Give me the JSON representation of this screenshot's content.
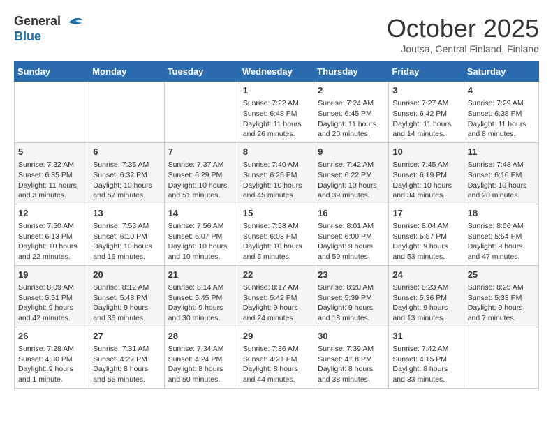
{
  "logo": {
    "general": "General",
    "blue": "Blue"
  },
  "title": "October 2025",
  "subtitle": "Joutsa, Central Finland, Finland",
  "days": [
    "Sunday",
    "Monday",
    "Tuesday",
    "Wednesday",
    "Thursday",
    "Friday",
    "Saturday"
  ],
  "weeks": [
    [
      {
        "num": "",
        "sunrise": "",
        "sunset": "",
        "daylight": ""
      },
      {
        "num": "",
        "sunrise": "",
        "sunset": "",
        "daylight": ""
      },
      {
        "num": "",
        "sunrise": "",
        "sunset": "",
        "daylight": ""
      },
      {
        "num": "1",
        "sunrise": "Sunrise: 7:22 AM",
        "sunset": "Sunset: 6:48 PM",
        "daylight": "Daylight: 11 hours and 26 minutes."
      },
      {
        "num": "2",
        "sunrise": "Sunrise: 7:24 AM",
        "sunset": "Sunset: 6:45 PM",
        "daylight": "Daylight: 11 hours and 20 minutes."
      },
      {
        "num": "3",
        "sunrise": "Sunrise: 7:27 AM",
        "sunset": "Sunset: 6:42 PM",
        "daylight": "Daylight: 11 hours and 14 minutes."
      },
      {
        "num": "4",
        "sunrise": "Sunrise: 7:29 AM",
        "sunset": "Sunset: 6:38 PM",
        "daylight": "Daylight: 11 hours and 8 minutes."
      }
    ],
    [
      {
        "num": "5",
        "sunrise": "Sunrise: 7:32 AM",
        "sunset": "Sunset: 6:35 PM",
        "daylight": "Daylight: 11 hours and 3 minutes."
      },
      {
        "num": "6",
        "sunrise": "Sunrise: 7:35 AM",
        "sunset": "Sunset: 6:32 PM",
        "daylight": "Daylight: 10 hours and 57 minutes."
      },
      {
        "num": "7",
        "sunrise": "Sunrise: 7:37 AM",
        "sunset": "Sunset: 6:29 PM",
        "daylight": "Daylight: 10 hours and 51 minutes."
      },
      {
        "num": "8",
        "sunrise": "Sunrise: 7:40 AM",
        "sunset": "Sunset: 6:26 PM",
        "daylight": "Daylight: 10 hours and 45 minutes."
      },
      {
        "num": "9",
        "sunrise": "Sunrise: 7:42 AM",
        "sunset": "Sunset: 6:22 PM",
        "daylight": "Daylight: 10 hours and 39 minutes."
      },
      {
        "num": "10",
        "sunrise": "Sunrise: 7:45 AM",
        "sunset": "Sunset: 6:19 PM",
        "daylight": "Daylight: 10 hours and 34 minutes."
      },
      {
        "num": "11",
        "sunrise": "Sunrise: 7:48 AM",
        "sunset": "Sunset: 6:16 PM",
        "daylight": "Daylight: 10 hours and 28 minutes."
      }
    ],
    [
      {
        "num": "12",
        "sunrise": "Sunrise: 7:50 AM",
        "sunset": "Sunset: 6:13 PM",
        "daylight": "Daylight: 10 hours and 22 minutes."
      },
      {
        "num": "13",
        "sunrise": "Sunrise: 7:53 AM",
        "sunset": "Sunset: 6:10 PM",
        "daylight": "Daylight: 10 hours and 16 minutes."
      },
      {
        "num": "14",
        "sunrise": "Sunrise: 7:56 AM",
        "sunset": "Sunset: 6:07 PM",
        "daylight": "Daylight: 10 hours and 10 minutes."
      },
      {
        "num": "15",
        "sunrise": "Sunrise: 7:58 AM",
        "sunset": "Sunset: 6:03 PM",
        "daylight": "Daylight: 10 hours and 5 minutes."
      },
      {
        "num": "16",
        "sunrise": "Sunrise: 8:01 AM",
        "sunset": "Sunset: 6:00 PM",
        "daylight": "Daylight: 9 hours and 59 minutes."
      },
      {
        "num": "17",
        "sunrise": "Sunrise: 8:04 AM",
        "sunset": "Sunset: 5:57 PM",
        "daylight": "Daylight: 9 hours and 53 minutes."
      },
      {
        "num": "18",
        "sunrise": "Sunrise: 8:06 AM",
        "sunset": "Sunset: 5:54 PM",
        "daylight": "Daylight: 9 hours and 47 minutes."
      }
    ],
    [
      {
        "num": "19",
        "sunrise": "Sunrise: 8:09 AM",
        "sunset": "Sunset: 5:51 PM",
        "daylight": "Daylight: 9 hours and 42 minutes."
      },
      {
        "num": "20",
        "sunrise": "Sunrise: 8:12 AM",
        "sunset": "Sunset: 5:48 PM",
        "daylight": "Daylight: 9 hours and 36 minutes."
      },
      {
        "num": "21",
        "sunrise": "Sunrise: 8:14 AM",
        "sunset": "Sunset: 5:45 PM",
        "daylight": "Daylight: 9 hours and 30 minutes."
      },
      {
        "num": "22",
        "sunrise": "Sunrise: 8:17 AM",
        "sunset": "Sunset: 5:42 PM",
        "daylight": "Daylight: 9 hours and 24 minutes."
      },
      {
        "num": "23",
        "sunrise": "Sunrise: 8:20 AM",
        "sunset": "Sunset: 5:39 PM",
        "daylight": "Daylight: 9 hours and 18 minutes."
      },
      {
        "num": "24",
        "sunrise": "Sunrise: 8:23 AM",
        "sunset": "Sunset: 5:36 PM",
        "daylight": "Daylight: 9 hours and 13 minutes."
      },
      {
        "num": "25",
        "sunrise": "Sunrise: 8:25 AM",
        "sunset": "Sunset: 5:33 PM",
        "daylight": "Daylight: 9 hours and 7 minutes."
      }
    ],
    [
      {
        "num": "26",
        "sunrise": "Sunrise: 7:28 AM",
        "sunset": "Sunset: 4:30 PM",
        "daylight": "Daylight: 9 hours and 1 minute."
      },
      {
        "num": "27",
        "sunrise": "Sunrise: 7:31 AM",
        "sunset": "Sunset: 4:27 PM",
        "daylight": "Daylight: 8 hours and 55 minutes."
      },
      {
        "num": "28",
        "sunrise": "Sunrise: 7:34 AM",
        "sunset": "Sunset: 4:24 PM",
        "daylight": "Daylight: 8 hours and 50 minutes."
      },
      {
        "num": "29",
        "sunrise": "Sunrise: 7:36 AM",
        "sunset": "Sunset: 4:21 PM",
        "daylight": "Daylight: 8 hours and 44 minutes."
      },
      {
        "num": "30",
        "sunrise": "Sunrise: 7:39 AM",
        "sunset": "Sunset: 4:18 PM",
        "daylight": "Daylight: 8 hours and 38 minutes."
      },
      {
        "num": "31",
        "sunrise": "Sunrise: 7:42 AM",
        "sunset": "Sunset: 4:15 PM",
        "daylight": "Daylight: 8 hours and 33 minutes."
      },
      {
        "num": "",
        "sunrise": "",
        "sunset": "",
        "daylight": ""
      }
    ]
  ]
}
